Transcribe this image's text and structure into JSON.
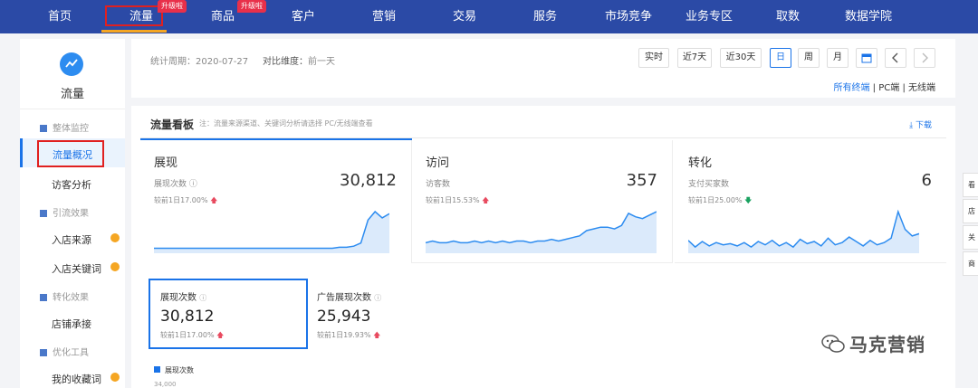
{
  "topnav": {
    "items": [
      "首页",
      "流量",
      "商品",
      "客户",
      "营销",
      "交易",
      "服务",
      "市场竞争",
      "业务专区",
      "取数",
      "数据学院"
    ],
    "badges": [
      "升级啦",
      "升级啦"
    ],
    "active": "流量"
  },
  "sidebar": {
    "title": "流量",
    "groups": [
      {
        "label": "整体监控"
      },
      {
        "label": "引流效果"
      },
      {
        "label": "转化效果"
      },
      {
        "label": "优化工具"
      }
    ],
    "items": [
      "流量概况",
      "访客分析",
      "入店来源",
      "入店关键词",
      "店铺承接",
      "我的收藏词"
    ],
    "active_item": "流量概况"
  },
  "toolbar": {
    "period_label": "统计周期：",
    "period_value": "2020-07-27",
    "compare_label": "对比维度：",
    "compare_value": "前一天",
    "buttons": [
      "实时",
      "近7天",
      "近30天",
      "日",
      "周",
      "月"
    ],
    "selected": "日",
    "terminals": [
      "所有终端",
      "PC端",
      "无线端"
    ],
    "terminal_sep": "|"
  },
  "board": {
    "title": "流量看板",
    "note": "注：流量来源渠道、关键词分析请选择 PC/无线端查看",
    "download": "下载"
  },
  "metrics": [
    {
      "title": "展现",
      "sub": "展现次数",
      "value": "30,812",
      "compare": "较前1日17.00%",
      "trend": "up",
      "color": "#2d8cf0",
      "spark": [
        3,
        3,
        3,
        3,
        3,
        3,
        3,
        3,
        3,
        3,
        3,
        3,
        3,
        3,
        3,
        3,
        3,
        3,
        3,
        3,
        3,
        3,
        3,
        3,
        3,
        3,
        4,
        4,
        5,
        8,
        30,
        38,
        32,
        36
      ]
    },
    {
      "title": "访问",
      "sub": "访客数",
      "value": "357",
      "compare": "较前1日15.53%",
      "trend": "up",
      "color": "#2d8cf0",
      "spark": [
        5,
        6,
        5,
        5,
        6,
        5,
        5,
        6,
        5,
        6,
        5,
        6,
        5,
        6,
        6,
        5,
        6,
        6,
        7,
        6,
        7,
        8,
        9,
        12,
        13,
        14,
        14,
        13,
        15,
        22,
        20,
        19,
        21,
        23
      ]
    },
    {
      "title": "转化",
      "sub": "支付买家数",
      "value": "6",
      "compare": "较前1日25.00%",
      "trend": "down",
      "color": "#2d8cf0",
      "spark": [
        10,
        4,
        9,
        5,
        8,
        6,
        7,
        5,
        8,
        4,
        9,
        6,
        10,
        5,
        8,
        4,
        11,
        7,
        9,
        5,
        12,
        6,
        8,
        13,
        9,
        5,
        10,
        6,
        8,
        12,
        36,
        20,
        14,
        16
      ]
    }
  ],
  "kpis": [
    {
      "label": "展现次数",
      "value": "30,812",
      "compare": "较前1日17.00%",
      "trend": "up"
    },
    {
      "label": "广告展现次数",
      "value": "25,943",
      "compare": "较前1日19.93%",
      "trend": "up"
    }
  ],
  "chart_legend": "展现次数",
  "chart_ytick": "34,000",
  "right_tabs": [
    "看",
    "店",
    "关",
    "商"
  ],
  "watermark": "马克营销"
}
